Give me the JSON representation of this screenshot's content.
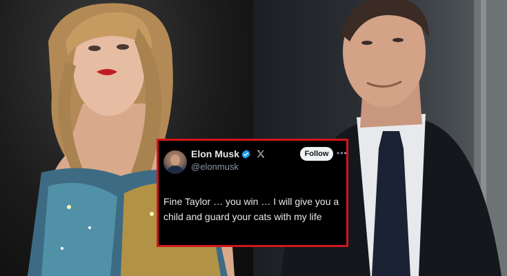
{
  "photos": {
    "left_icon": "woman-performer-photo",
    "right_icon": "man-in-suit-photo"
  },
  "tweet": {
    "author_name": "Elon Musk",
    "handle": "@elonmusk",
    "verified_icon": "verified-badge-icon",
    "platform_icon": "x-logo-icon",
    "follow_label": "Follow",
    "more_icon": "more-options-icon",
    "more_glyph": "•••",
    "text": "Fine Taylor … you win … I will give you a child and guard your cats with my life",
    "border_color": "#d0161b",
    "accent_color": "#1d9bf0"
  }
}
